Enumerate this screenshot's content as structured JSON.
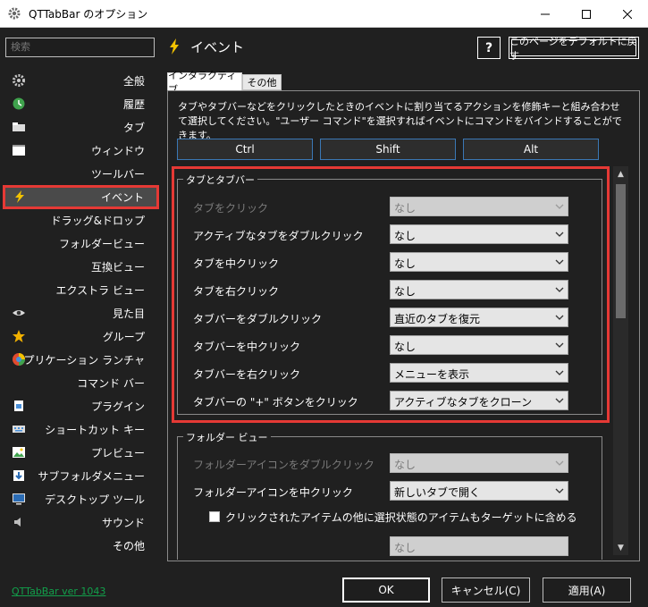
{
  "window": {
    "title": "QTTabBar のオプション"
  },
  "sidebar": {
    "search_placeholder": "検索",
    "items": [
      {
        "label": "全般",
        "icon": "gear-icon"
      },
      {
        "label": "履歴",
        "icon": "history-icon"
      },
      {
        "label": "タブ",
        "icon": "tab-icon"
      },
      {
        "label": "ウィンドウ",
        "icon": "window-icon"
      },
      {
        "label": "ツールバー",
        "icon": ""
      },
      {
        "label": "イベント",
        "icon": "lightning-icon"
      },
      {
        "label": "ドラッグ&ドロップ",
        "icon": ""
      },
      {
        "label": "フォルダービュー",
        "icon": ""
      },
      {
        "label": "互換ビュー",
        "icon": ""
      },
      {
        "label": "エクストラ ビュー",
        "icon": ""
      },
      {
        "label": "見た目",
        "icon": "eye-icon"
      },
      {
        "label": "グループ",
        "icon": "star-icon"
      },
      {
        "label": "アプリケーション ランチャ",
        "icon": "launcher-icon"
      },
      {
        "label": "コマンド バー",
        "icon": ""
      },
      {
        "label": "プラグイン",
        "icon": "plugin-icon"
      },
      {
        "label": "ショートカット キー",
        "icon": "keyboard-icon"
      },
      {
        "label": "プレビュー",
        "icon": "preview-icon"
      },
      {
        "label": "サブフォルダメニュー",
        "icon": "subfolder-icon"
      },
      {
        "label": "デスクトップ ツール",
        "icon": "desktop-icon"
      },
      {
        "label": "サウンド",
        "icon": "speaker-icon"
      },
      {
        "label": "その他",
        "icon": ""
      }
    ],
    "active_index": 5
  },
  "header": {
    "title": "イベント",
    "help_label": "?",
    "reset_label": "このページをデフォルトに戻す"
  },
  "tabs": [
    {
      "label": "インタラクティブ"
    },
    {
      "label": "その他"
    }
  ],
  "description": "タブやタブバーなどをクリックしたときのイベントに割り当てるアクションを修飾キーと組み合わせて選択してください。\"ユーザー コマンド\"を選択すればイベントにコマンドをバインドすることができます。",
  "modifiers": [
    "Ctrl",
    "Shift",
    "Alt"
  ],
  "group_tabs": {
    "title": "タブとタブバー",
    "rows": [
      {
        "label": "タブをクリック",
        "value": "なし",
        "disabled": true
      },
      {
        "label": "アクティブなタブをダブルクリック",
        "value": "なし",
        "disabled": false
      },
      {
        "label": "タブを中クリック",
        "value": "なし",
        "disabled": false
      },
      {
        "label": "タブを右クリック",
        "value": "なし",
        "disabled": false
      },
      {
        "label": "タブバーをダブルクリック",
        "value": "直近のタブを復元",
        "disabled": false
      },
      {
        "label": "タブバーを中クリック",
        "value": "なし",
        "disabled": false
      },
      {
        "label": "タブバーを右クリック",
        "value": "メニューを表示",
        "disabled": false
      },
      {
        "label": "タブバーの \"+\" ボタンをクリック",
        "value": "アクティブなタブをクローン",
        "disabled": false
      }
    ]
  },
  "group_folder": {
    "title": "フォルダー ビュー",
    "rows": [
      {
        "label": "フォルダーアイコンをダブルクリック",
        "value": "なし",
        "disabled": true
      },
      {
        "label": "フォルダーアイコンを中クリック",
        "value": "新しいタブで開く",
        "disabled": false
      }
    ],
    "checkbox_label": "クリックされたアイテムの他に選択状態のアイテムもターゲットに含める",
    "checkbox_checked": false,
    "partial_value": "なし"
  },
  "footer": {
    "version": "QTTabBar ver 1043",
    "ok": "OK",
    "cancel": "キャンセル(C)",
    "apply": "適用(A)"
  },
  "colors": {
    "accent_red": "#e53935",
    "link_green": "#12a04b",
    "modifier_border": "#3b78b5"
  }
}
